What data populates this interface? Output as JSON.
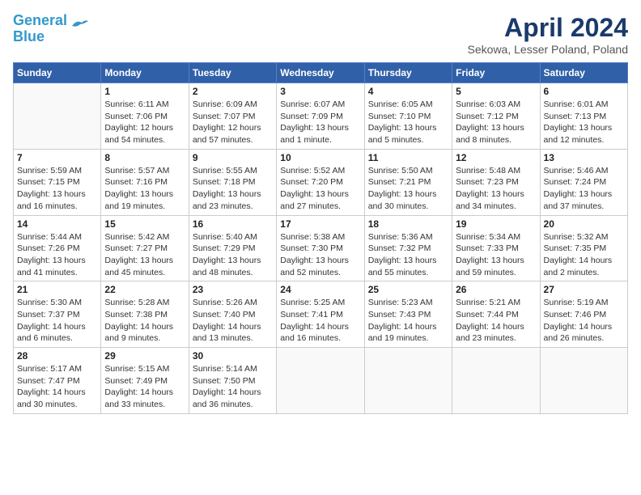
{
  "header": {
    "logo_line1": "General",
    "logo_line2": "Blue",
    "month": "April 2024",
    "location": "Sekowa, Lesser Poland, Poland"
  },
  "weekdays": [
    "Sunday",
    "Monday",
    "Tuesday",
    "Wednesday",
    "Thursday",
    "Friday",
    "Saturday"
  ],
  "weeks": [
    [
      {
        "day": "",
        "info": ""
      },
      {
        "day": "1",
        "info": "Sunrise: 6:11 AM\nSunset: 7:06 PM\nDaylight: 12 hours\nand 54 minutes."
      },
      {
        "day": "2",
        "info": "Sunrise: 6:09 AM\nSunset: 7:07 PM\nDaylight: 12 hours\nand 57 minutes."
      },
      {
        "day": "3",
        "info": "Sunrise: 6:07 AM\nSunset: 7:09 PM\nDaylight: 13 hours\nand 1 minute."
      },
      {
        "day": "4",
        "info": "Sunrise: 6:05 AM\nSunset: 7:10 PM\nDaylight: 13 hours\nand 5 minutes."
      },
      {
        "day": "5",
        "info": "Sunrise: 6:03 AM\nSunset: 7:12 PM\nDaylight: 13 hours\nand 8 minutes."
      },
      {
        "day": "6",
        "info": "Sunrise: 6:01 AM\nSunset: 7:13 PM\nDaylight: 13 hours\nand 12 minutes."
      }
    ],
    [
      {
        "day": "7",
        "info": "Sunrise: 5:59 AM\nSunset: 7:15 PM\nDaylight: 13 hours\nand 16 minutes."
      },
      {
        "day": "8",
        "info": "Sunrise: 5:57 AM\nSunset: 7:16 PM\nDaylight: 13 hours\nand 19 minutes."
      },
      {
        "day": "9",
        "info": "Sunrise: 5:55 AM\nSunset: 7:18 PM\nDaylight: 13 hours\nand 23 minutes."
      },
      {
        "day": "10",
        "info": "Sunrise: 5:52 AM\nSunset: 7:20 PM\nDaylight: 13 hours\nand 27 minutes."
      },
      {
        "day": "11",
        "info": "Sunrise: 5:50 AM\nSunset: 7:21 PM\nDaylight: 13 hours\nand 30 minutes."
      },
      {
        "day": "12",
        "info": "Sunrise: 5:48 AM\nSunset: 7:23 PM\nDaylight: 13 hours\nand 34 minutes."
      },
      {
        "day": "13",
        "info": "Sunrise: 5:46 AM\nSunset: 7:24 PM\nDaylight: 13 hours\nand 37 minutes."
      }
    ],
    [
      {
        "day": "14",
        "info": "Sunrise: 5:44 AM\nSunset: 7:26 PM\nDaylight: 13 hours\nand 41 minutes."
      },
      {
        "day": "15",
        "info": "Sunrise: 5:42 AM\nSunset: 7:27 PM\nDaylight: 13 hours\nand 45 minutes."
      },
      {
        "day": "16",
        "info": "Sunrise: 5:40 AM\nSunset: 7:29 PM\nDaylight: 13 hours\nand 48 minutes."
      },
      {
        "day": "17",
        "info": "Sunrise: 5:38 AM\nSunset: 7:30 PM\nDaylight: 13 hours\nand 52 minutes."
      },
      {
        "day": "18",
        "info": "Sunrise: 5:36 AM\nSunset: 7:32 PM\nDaylight: 13 hours\nand 55 minutes."
      },
      {
        "day": "19",
        "info": "Sunrise: 5:34 AM\nSunset: 7:33 PM\nDaylight: 13 hours\nand 59 minutes."
      },
      {
        "day": "20",
        "info": "Sunrise: 5:32 AM\nSunset: 7:35 PM\nDaylight: 14 hours\nand 2 minutes."
      }
    ],
    [
      {
        "day": "21",
        "info": "Sunrise: 5:30 AM\nSunset: 7:37 PM\nDaylight: 14 hours\nand 6 minutes."
      },
      {
        "day": "22",
        "info": "Sunrise: 5:28 AM\nSunset: 7:38 PM\nDaylight: 14 hours\nand 9 minutes."
      },
      {
        "day": "23",
        "info": "Sunrise: 5:26 AM\nSunset: 7:40 PM\nDaylight: 14 hours\nand 13 minutes."
      },
      {
        "day": "24",
        "info": "Sunrise: 5:25 AM\nSunset: 7:41 PM\nDaylight: 14 hours\nand 16 minutes."
      },
      {
        "day": "25",
        "info": "Sunrise: 5:23 AM\nSunset: 7:43 PM\nDaylight: 14 hours\nand 19 minutes."
      },
      {
        "day": "26",
        "info": "Sunrise: 5:21 AM\nSunset: 7:44 PM\nDaylight: 14 hours\nand 23 minutes."
      },
      {
        "day": "27",
        "info": "Sunrise: 5:19 AM\nSunset: 7:46 PM\nDaylight: 14 hours\nand 26 minutes."
      }
    ],
    [
      {
        "day": "28",
        "info": "Sunrise: 5:17 AM\nSunset: 7:47 PM\nDaylight: 14 hours\nand 30 minutes."
      },
      {
        "day": "29",
        "info": "Sunrise: 5:15 AM\nSunset: 7:49 PM\nDaylight: 14 hours\nand 33 minutes."
      },
      {
        "day": "30",
        "info": "Sunrise: 5:14 AM\nSunset: 7:50 PM\nDaylight: 14 hours\nand 36 minutes."
      },
      {
        "day": "",
        "info": ""
      },
      {
        "day": "",
        "info": ""
      },
      {
        "day": "",
        "info": ""
      },
      {
        "day": "",
        "info": ""
      }
    ]
  ]
}
